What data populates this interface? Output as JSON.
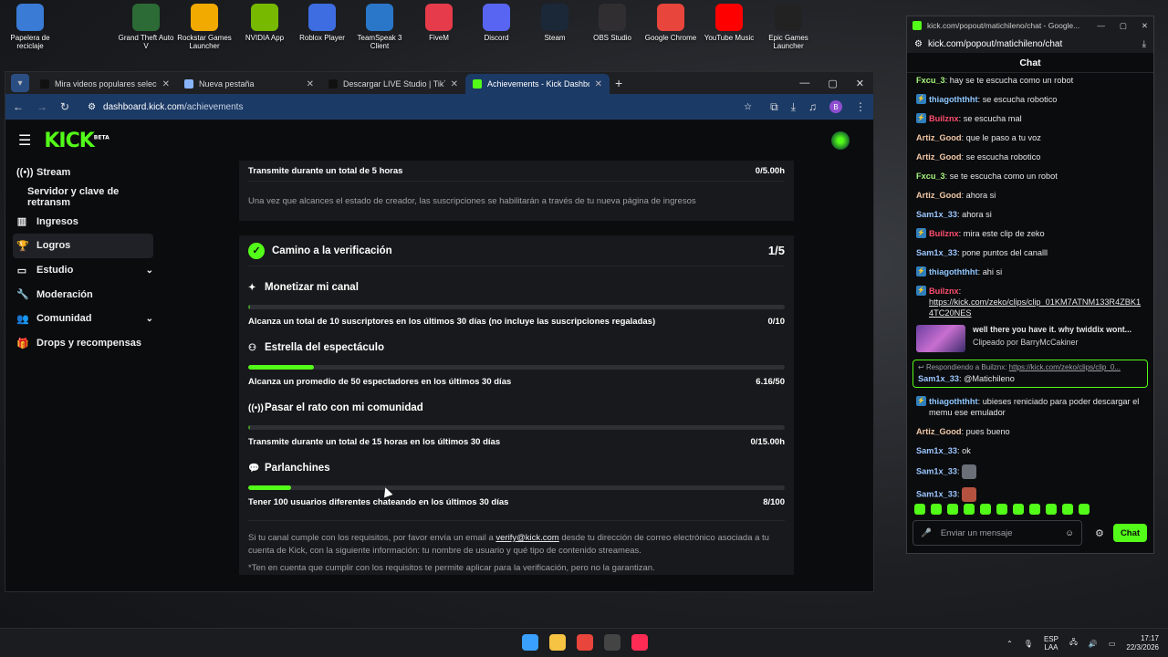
{
  "desktop": {
    "icons": [
      {
        "label": "Papelera de reciclaje",
        "color": "#3a7bd5"
      },
      {
        "label": "Grand Theft Auto V",
        "color": "#2c6b35"
      },
      {
        "label": "Rockstar Games Launcher",
        "color": "#f2a900"
      },
      {
        "label": "NVIDIA App",
        "color": "#76b900"
      },
      {
        "label": "Roblox Player",
        "color": "#3d6de0"
      },
      {
        "label": "TeamSpeak 3 Client",
        "color": "#2a77c9"
      },
      {
        "label": "FiveM",
        "color": "#e63b4a"
      },
      {
        "label": "Discord",
        "color": "#5865f2"
      },
      {
        "label": "Steam",
        "color": "#1b2838"
      },
      {
        "label": "OBS Studio",
        "color": "#302e31"
      },
      {
        "label": "Google Chrome",
        "color": "#e8453c"
      },
      {
        "label": "YouTube Music",
        "color": "#ff0000"
      },
      {
        "label": "Epic Games Launcher",
        "color": "#222222"
      }
    ]
  },
  "browser": {
    "tabs": [
      {
        "title": "Mira videos populares seleccio",
        "favicon_color": "#111111"
      },
      {
        "title": "Nueva pestaña",
        "favicon_color": "#8ab4f8"
      },
      {
        "title": "Descargar LIVE Studio | TikTok",
        "favicon_color": "#111111"
      },
      {
        "title": "Achievements - Kick Dashboard",
        "favicon_color": "#53fc18"
      }
    ],
    "url_host": "dashboard.kick.com",
    "url_path": "/achievements",
    "profile_initial": "B"
  },
  "kick": {
    "logo": "KICK",
    "logo_beta": "BETA",
    "accent": "#53fc18",
    "sidebar": [
      {
        "label": "Stream",
        "icon": "broadcast-icon",
        "glyph": "((•))"
      },
      {
        "label": "Servidor y clave de retransm",
        "icon": "",
        "glyph": ""
      },
      {
        "label": "Ingresos",
        "icon": "chart-icon",
        "glyph": "▥"
      },
      {
        "label": "Logros",
        "icon": "trophy-icon",
        "glyph": "🏆"
      },
      {
        "label": "Estudio",
        "icon": "studio-icon",
        "glyph": "▭"
      },
      {
        "label": "Moderación",
        "icon": "wrench-icon",
        "glyph": "🔧"
      },
      {
        "label": "Comunidad",
        "icon": "users-icon",
        "glyph": "👥"
      },
      {
        "label": "Drops y recompensas",
        "icon": "gift-icon",
        "glyph": "🎁"
      }
    ],
    "creator_card": {
      "row_label": "Transmite durante un total de 5 horas",
      "row_value": "0/5.00h",
      "note": "Una vez que alcances el estado de creador, las suscripciones se habilitarán a través de tu nueva página de ingresos"
    },
    "verification": {
      "title": "Camino a la verificación",
      "progress": "1/5",
      "requirements": [
        {
          "title": "Monetizar mi canal",
          "glyph": "✦",
          "icon": "sparkle-icon",
          "desc": "Alcanza un total de 10 suscriptores en los últimos 30 días (no incluye las suscripciones regaladas)",
          "value": "0/10",
          "fraction": 0.0
        },
        {
          "title": "Estrella del espectáculo",
          "glyph": "⚇",
          "icon": "viewers-icon",
          "desc": "Alcanza un promedio de 50 espectadores en los últimos 30 días",
          "value": "6.16/50",
          "fraction": 0.1232
        },
        {
          "title": "Pasar el rato con mi comunidad",
          "glyph": "((•))",
          "icon": "broadcast-icon",
          "desc": "Transmite durante un total de 15 horas en los últimos 30 días",
          "value": "0/15.00h",
          "fraction": 0.0
        },
        {
          "title": "Parlanchines",
          "glyph": "💬",
          "icon": "chat-bubble-icon",
          "desc": "Tener 100 usuarios diferentes chateando en los últimos 30 días",
          "value": "8/100",
          "fraction": 0.08
        }
      ],
      "footer_pre": "Si tu canal cumple con los requisitos, por favor envía un email a ",
      "footer_email": "verify@kick.com",
      "footer_post": " desde tu dirección de correo electrónico asociada a tu cuenta de Kick, con la siguiente información: tu nombre de usuario y qué tipo de contenido streameas.",
      "footer_warn": "*Ten en cuenta que cumplir con los requisitos te permite aplicar para la verificación, pero no la garantizan."
    }
  },
  "chat": {
    "window_title": "kick.com/popout/matichileno/chat - Google...",
    "url": "kick.com/popout/matichileno/chat",
    "header": "Chat",
    "messages": [
      {
        "user": "Fxcu_3",
        "color": "#a6f57a",
        "badge": false,
        "text": "hay se te escucha como un robot"
      },
      {
        "user": "thiagoththht",
        "color": "#8ec7ff",
        "badge": true,
        "text": "se escucha robotico"
      },
      {
        "user": "Builznx",
        "color": "#ff4d6d",
        "badge": true,
        "text": "se escucha mal"
      },
      {
        "user": "Artiz_Good",
        "color": "#f1c8a6",
        "badge": false,
        "text": "que le paso a tu voz"
      },
      {
        "user": "Artiz_Good",
        "color": "#f1c8a6",
        "badge": false,
        "text": "se escucha robotico"
      },
      {
        "user": "Fxcu_3",
        "color": "#a6f57a",
        "badge": false,
        "text": "se te escucha como un robot"
      },
      {
        "user": "Artiz_Good",
        "color": "#f1c8a6",
        "badge": false,
        "text": "ahora si"
      },
      {
        "user": "Sam1x_33",
        "color": "#9cc6ff",
        "badge": false,
        "text": "ahora si"
      },
      {
        "user": "Builznx",
        "color": "#ff4d6d",
        "badge": true,
        "text": "mira este clip de zeko"
      },
      {
        "user": "Sam1x_33",
        "color": "#9cc6ff",
        "badge": false,
        "text": "pone puntos del canalll"
      },
      {
        "user": "thiagoththht",
        "color": "#8ec7ff",
        "badge": true,
        "text": "ahi si"
      }
    ],
    "link_msg": {
      "user": "Builznx",
      "color": "#ff4d6d",
      "link": "https://kick.com/zeko/clips/clip_01KM7ATNM133R4ZBK14TC20NES"
    },
    "clip": {
      "title": "well there you have it. why twiddix wont...",
      "by": "Clipeado por BarryMcCakiner"
    },
    "reply": {
      "header_pre": "Respondiendo a Builznx: ",
      "header_link": "https://kick.com/zeko/clips/clip_0...",
      "user": "Sam1x_33",
      "color": "#9cc6ff",
      "text": "@Matichileno"
    },
    "messages2": [
      {
        "user": "thiagoththht",
        "color": "#8ec7ff",
        "badge": true,
        "text": "ubieses reniciado para poder descargar el memu ese emulador"
      },
      {
        "user": "Artiz_Good",
        "color": "#f1c8a6",
        "badge": false,
        "text": "pues bueno"
      },
      {
        "user": "Sam1x_33",
        "color": "#9cc6ff",
        "badge": false,
        "text": "ok"
      }
    ],
    "emote_msgs": [
      {
        "user": "Sam1x_33",
        "color": "#9cc6ff",
        "emote_color": "#6b6f78"
      },
      {
        "user": "Sam1x_33",
        "color": "#9cc6ff",
        "emote_color": "#b5523f"
      }
    ],
    "input_placeholder": "Enviar un mensaje",
    "send_label": "Chat"
  },
  "taskbar": {
    "apps": [
      {
        "name": "windows-start-icon",
        "color": "#3aa0ff"
      },
      {
        "name": "file-explorer-icon",
        "color": "#f6c343"
      },
      {
        "name": "chrome-icon",
        "color": "#e8453c"
      },
      {
        "name": "obs-icon",
        "color": "#444444"
      },
      {
        "name": "tiktok-icon",
        "color": "#fe2c55"
      }
    ],
    "lang_top": "ESP",
    "lang_bottom": "LAA",
    "time": "17:17",
    "date": "22/3/2026"
  }
}
